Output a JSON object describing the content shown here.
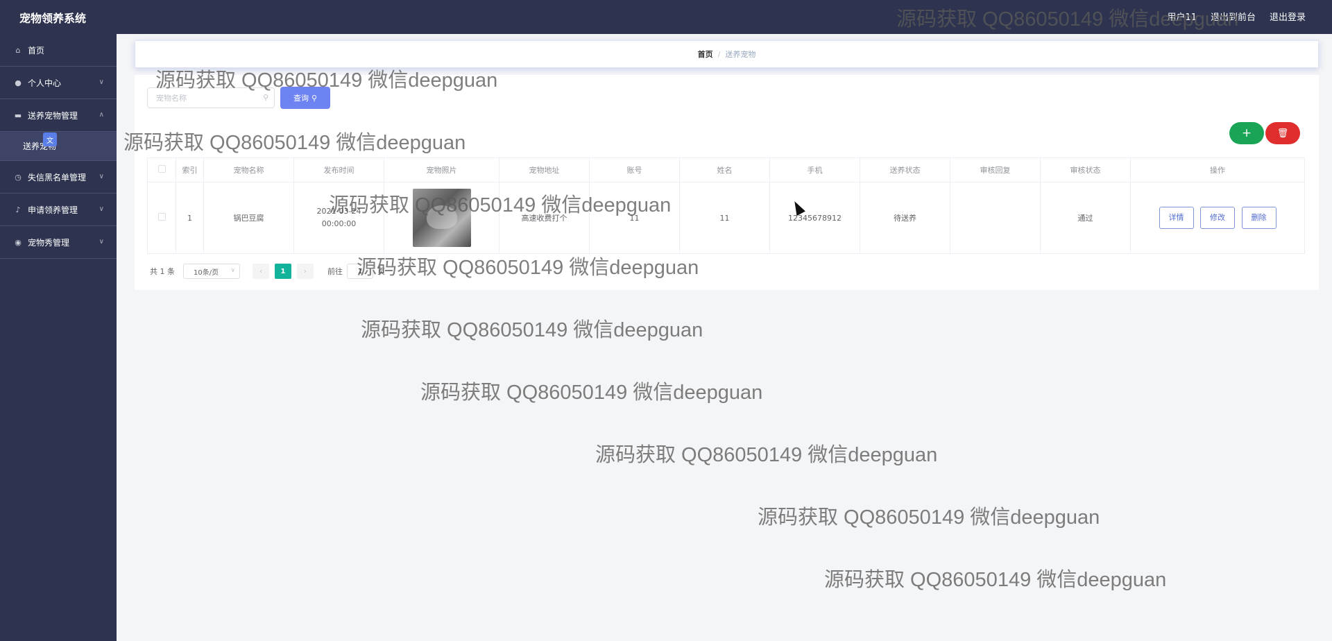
{
  "header": {
    "app_title": "宠物领养系统",
    "user": "用户11",
    "back_to_frontend": "退出到前台",
    "logout": "退出登录"
  },
  "sidebar": {
    "items": [
      {
        "label": "首页",
        "icon": "home-icon"
      },
      {
        "label": "个人中心",
        "icon": "user-icon"
      },
      {
        "label": "送养宠物管理",
        "icon": "box-icon",
        "expanded": true,
        "children": [
          {
            "label": "送养宠物"
          }
        ]
      },
      {
        "label": "失信黑名单管理",
        "icon": "clock-icon"
      },
      {
        "label": "申请领养管理",
        "icon": "mic-icon"
      },
      {
        "label": "宠物秀管理",
        "icon": "bulb-icon"
      }
    ]
  },
  "breadcrumb": {
    "home": "首页",
    "separator": "/",
    "current": "送养宠物"
  },
  "search": {
    "placeholder": "宠物名称",
    "button": "查询"
  },
  "table": {
    "columns": [
      "索引",
      "宠物名称",
      "发布时间",
      "宠物照片",
      "宠物地址",
      "账号",
      "姓名",
      "手机",
      "送养状态",
      "审核回复",
      "审核状态",
      "操作"
    ],
    "rows": [
      {
        "index": "1",
        "pet_name": "锅巴豆腐",
        "publish_time": "2021-03-24 00:00:00",
        "pet_address": "高速收费打个",
        "account": "11",
        "name": "11",
        "phone": "12345678912",
        "adopt_status": "待送养",
        "review_reply": "",
        "review_status": "通过",
        "actions": {
          "detail": "详情",
          "edit": "修改",
          "delete": "删除"
        }
      }
    ]
  },
  "pagination": {
    "total": "共 1 条",
    "page_size": "10条/页",
    "current_page": "1",
    "goto_label": "前往",
    "goto_value": "1",
    "page_unit": "页"
  },
  "watermark": "源码获取 QQ86050149 微信deepguan",
  "colors": {
    "sidebar_bg": "#2e344f",
    "primary": "#6d83f2",
    "add_green": "#19a555",
    "delete_red": "#e02d2d",
    "page_active": "#13b29b"
  }
}
